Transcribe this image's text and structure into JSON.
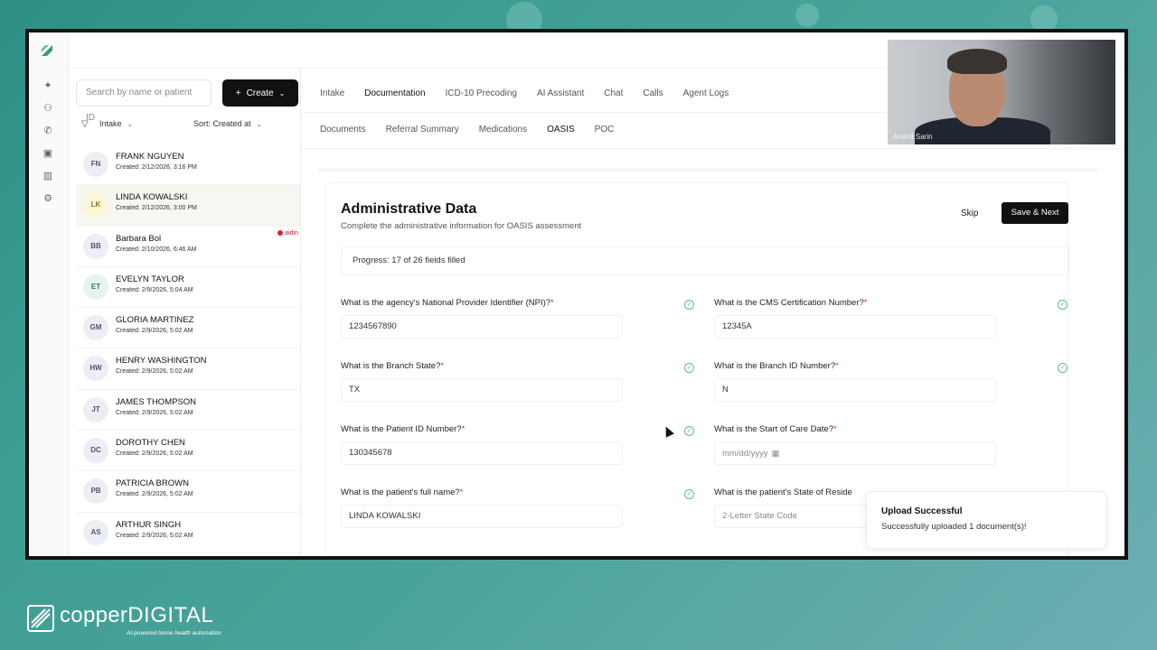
{
  "brand": {
    "name_part1": "copper",
    "name_part2": "DIGITAL",
    "tagline": "AI-powered home health automation"
  },
  "video": {
    "participant_name": "Arvind Sarin"
  },
  "sidebar": {
    "search_placeholder": "Search by name or patient ID",
    "create_label": "Create",
    "filter_status": "Intake",
    "sort_label": "Sort: Created at",
    "patients": [
      {
        "initials": "FN",
        "name": "FRANK NGUYEN",
        "created": "Created: 2/12/2026, 3:16 PM"
      },
      {
        "initials": "LK",
        "name": "LINDA KOWALSKI",
        "created": "Created: 2/12/2026, 3:00 PM"
      },
      {
        "initials": "BB",
        "name": "Barbara Bol",
        "created": "Created: 2/10/2026, 6:46 AM",
        "tag": "aidin"
      },
      {
        "initials": "ET",
        "name": "EVELYN TAYLOR",
        "created": "Created: 2/9/2026, 5:04 AM"
      },
      {
        "initials": "GM",
        "name": "GLORIA MARTINEZ",
        "created": "Created: 2/9/2026, 5:02 AM"
      },
      {
        "initials": "HW",
        "name": "HENRY WASHINGTON",
        "created": "Created: 2/9/2026, 5:02 AM"
      },
      {
        "initials": "JT",
        "name": "JAMES THOMPSON",
        "created": "Created: 2/9/2026, 5:02 AM"
      },
      {
        "initials": "DC",
        "name": "DOROTHY CHEN",
        "created": "Created: 2/9/2026, 5:02 AM"
      },
      {
        "initials": "PB",
        "name": "PATRICIA BROWN",
        "created": "Created: 2/9/2026, 5:02 AM"
      },
      {
        "initials": "AS",
        "name": "ARTHUR SINGH",
        "created": "Created: 2/9/2026, 5:02 AM"
      }
    ]
  },
  "tabs_primary": [
    "Intake",
    "Documentation",
    "ICD-10 Precoding",
    "AI Assistant",
    "Chat",
    "Calls",
    "Agent Logs"
  ],
  "tabs_primary_active": "Documentation",
  "tabs_secondary": [
    "Documents",
    "Referral Summary",
    "Medications",
    "OASIS",
    "POC"
  ],
  "tabs_secondary_active": "OASIS",
  "form": {
    "title": "Administrative Data",
    "subtitle": "Complete the administrative information for OASIS assessment",
    "skip_label": "Skip",
    "save_label": "Save & Next",
    "progress_text": "Progress: 17 of 26 fields filled",
    "fields": {
      "npi": {
        "question": "What is the agency's National Provider Identifier (NPI)?",
        "value": "1234567890"
      },
      "cms": {
        "question": "What is the CMS Certification Number?",
        "value": "12345A"
      },
      "branch_state": {
        "question": "What is the Branch State?",
        "value": "TX"
      },
      "branch_id": {
        "question": "What is the Branch ID Number?",
        "value": "N"
      },
      "patient_id": {
        "question": "What is the Patient ID Number?",
        "value": "130345678"
      },
      "start_of_care": {
        "question": "What is the Start of Care Date?",
        "placeholder": "mm/dd/yyyy"
      },
      "full_name": {
        "question": "What is the patient's full name?",
        "value": "LINDA KOWALSKI"
      },
      "state_residence": {
        "question": "What is the patient's State of Reside",
        "placeholder": "2-Letter State Code"
      }
    },
    "required_mark": "*"
  },
  "toast": {
    "title": "Upload Successful",
    "message": "Successfully uploaded 1 document(s)!"
  },
  "colors": {
    "accent_dark": "#111111",
    "check_green": "#5bbf8a",
    "required_red": "#d33333",
    "brand_teal": "#3f9e95"
  }
}
